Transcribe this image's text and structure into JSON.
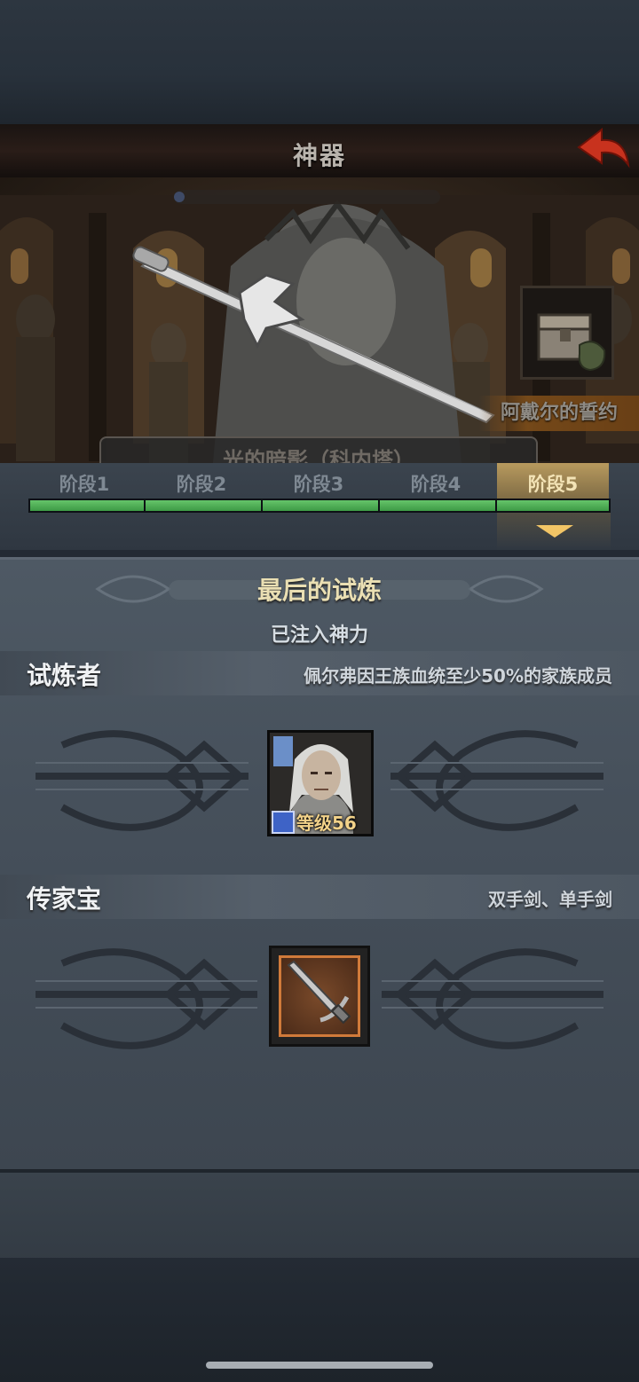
{
  "header": {
    "title": "神器",
    "back_icon": "back-arrow-icon"
  },
  "banner": {
    "artifact_name": "阿戴尔的誓约",
    "subtitle": "光的暗影（科内塔）",
    "chest_icon": "treasure-chest-icon"
  },
  "stages": {
    "tabs": [
      "阶段1",
      "阶段2",
      "阶段3",
      "阶段4",
      "阶段5"
    ],
    "active_index": 4,
    "progress_fraction": 1.0,
    "fill_color": "#4caf50",
    "active_color": "#b89a5e"
  },
  "trial": {
    "title": "最后的试炼",
    "status": "已注入神力"
  },
  "challenger": {
    "label": "试炼者",
    "requirement": "佩尔弗因王族血统至少50%的家族成员",
    "hero_level": "等级56"
  },
  "heirloom": {
    "label": "传家宝",
    "requirement": "双手剑、单手剑"
  }
}
